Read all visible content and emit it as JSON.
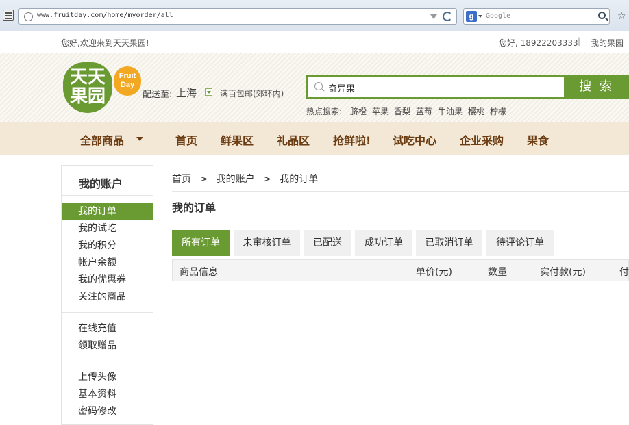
{
  "browser": {
    "url": "www.fruitday.com/home/myorder/all",
    "search_engine": "Google"
  },
  "topbar": {
    "welcome": "您好,欢迎来到天天果园!",
    "user": "您好, 18922203333",
    "divider": "|",
    "my_account_link": "我的果园"
  },
  "header": {
    "logo_text": [
      "天天",
      "果园"
    ],
    "logo_badge": [
      "Fruit",
      "Day"
    ],
    "delivery_label": "配送至:",
    "city": "上海",
    "shipping": "满百包邮(郊环内)",
    "search_value": "奇异果",
    "search_button": "搜 索",
    "hot_label": "热点搜索:",
    "hot_items": [
      "脐橙",
      "苹果",
      "香梨",
      "蓝莓",
      "牛油果",
      "樱桃",
      "柠檬"
    ]
  },
  "nav": {
    "items": [
      "全部商品",
      "首页",
      "鲜果区",
      "礼品区",
      "抢鲜啦!",
      "试吃中心",
      "企业采购",
      "果食"
    ]
  },
  "sidebar": {
    "title": "我的账户",
    "groups": [
      [
        "我的订单",
        "我的试吃",
        "我的积分",
        "帐户余额",
        "我的优惠券",
        "关注的商品"
      ],
      [
        "在线充值",
        "领取赠品"
      ],
      [
        "上传头像",
        "基本资料",
        "密码修改"
      ]
    ],
    "active": "我的订单"
  },
  "main": {
    "breadcrumb": [
      "首页",
      ">",
      "我的账户",
      ">",
      "我的订单"
    ],
    "title": "我的订单",
    "tabs": [
      "所有订单",
      "未审核订单",
      "已配送",
      "成功订单",
      "已取消订单",
      "待评论订单"
    ],
    "active_tab": "所有订单",
    "columns": [
      "商品信息",
      "单价(元)",
      "数量",
      "实付款(元)",
      "付"
    ]
  },
  "colors": {
    "brand_green": "#6a9a32",
    "nav_bg": "#f3e8d6",
    "badge_orange": "#f3a822"
  }
}
